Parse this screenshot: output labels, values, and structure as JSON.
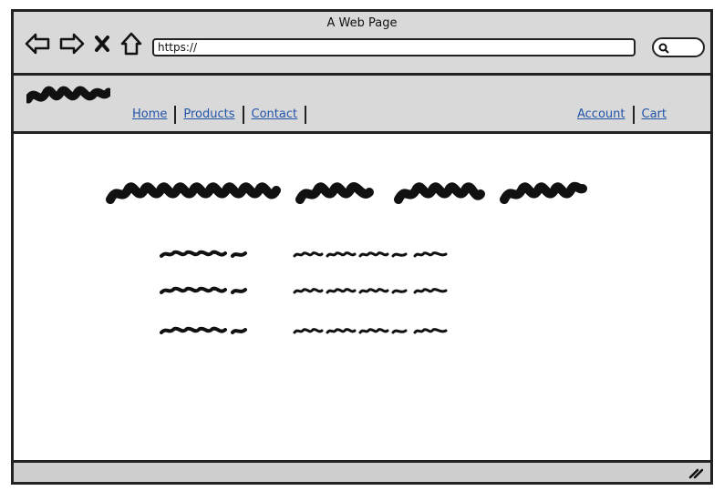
{
  "window": {
    "title": "A Web Page"
  },
  "toolbar": {
    "back_icon": "back-arrow-icon",
    "forward_icon": "forward-arrow-icon",
    "stop_icon": "close-x-icon",
    "home_icon": "home-icon",
    "url": "https://",
    "search_icon": "search-icon"
  },
  "header": {
    "logo": "scribble-logo",
    "nav_left": [
      "Home",
      "Products",
      "Contact"
    ],
    "nav_right": [
      "Account",
      "Cart"
    ]
  },
  "colors": {
    "chrome": "#d9d9d9",
    "link": "#2255aa",
    "border": "#222222"
  }
}
